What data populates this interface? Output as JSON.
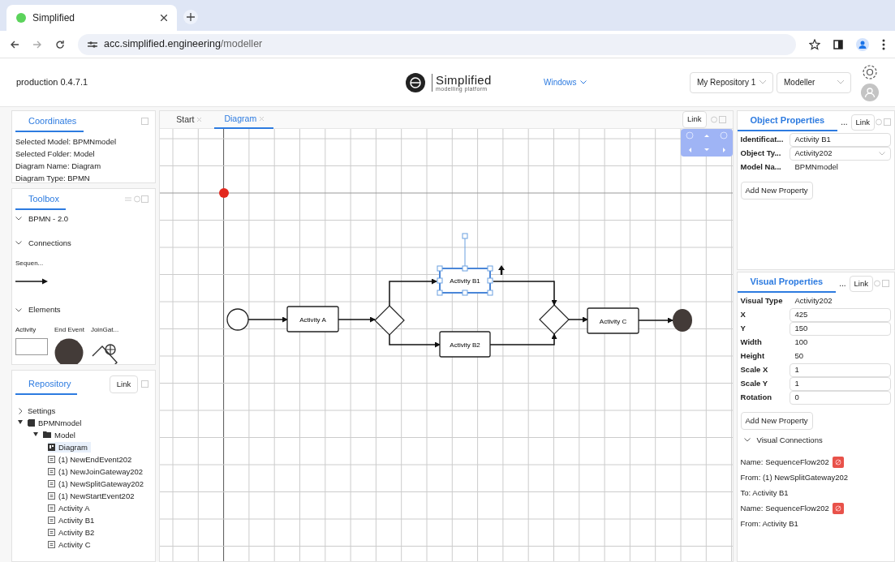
{
  "browser": {
    "tab_title": "Simplified",
    "url_host": "acc.simplified.engineering",
    "url_path": "/modeller"
  },
  "header": {
    "version": "production 0.4.7.1",
    "logo_title": "Simplified",
    "logo_subtitle": "modelling platform",
    "windows_menu": "Windows",
    "repository_select": "My Repository 1",
    "mode_select": "Modeller"
  },
  "coordinates": {
    "title": "Coordinates",
    "lines": [
      "Selected Model: BPMNmodel",
      "Selected Folder: Model",
      "Diagram Name: Diagram",
      "Diagram Type: BPMN"
    ]
  },
  "toolbox": {
    "title": "Toolbox",
    "group": "BPMN - 2.0",
    "connections_label": "Connections",
    "connections": [
      {
        "label": "Sequen..."
      }
    ],
    "elements_label": "Elements",
    "elements": [
      {
        "label": "Activity",
        "kind": "activity"
      },
      {
        "label": "End Event",
        "kind": "end"
      },
      {
        "label": "JoinGat...",
        "kind": "join"
      }
    ]
  },
  "repository": {
    "title": "Repository",
    "link": "Link",
    "tree": [
      {
        "label": "Settings",
        "kind": "folder-toggle",
        "expanded": false,
        "selected": false
      },
      {
        "label": "BPMNmodel",
        "kind": "model",
        "expanded": true,
        "selected": false,
        "children": [
          {
            "label": "Model",
            "kind": "folder",
            "expanded": true,
            "selected": false,
            "children": [
              {
                "label": "Diagram",
                "kind": "diagram",
                "selected": true
              },
              {
                "label": "(1) NewEndEvent202",
                "kind": "object",
                "selected": false
              },
              {
                "label": "(1) NewJoinGateway202",
                "kind": "object",
                "selected": false
              },
              {
                "label": "(1) NewSplitGateway202",
                "kind": "object",
                "selected": false
              },
              {
                "label": "(1) NewStartEvent202",
                "kind": "object",
                "selected": false
              },
              {
                "label": "Activity A",
                "kind": "object",
                "selected": false
              },
              {
                "label": "Activity B1",
                "kind": "object",
                "selected": false
              },
              {
                "label": "Activity B2",
                "kind": "object",
                "selected": false
              },
              {
                "label": "Activity C",
                "kind": "object",
                "selected": false
              }
            ]
          }
        ]
      }
    ]
  },
  "editor": {
    "tabs": [
      {
        "label": "Start",
        "selected": false
      },
      {
        "label": "Diagram",
        "selected": true
      }
    ],
    "link": "Link",
    "nodes": [
      {
        "kind": "start"
      },
      {
        "kind": "activity",
        "label": "Activity A",
        "selected": false
      },
      {
        "kind": "gateway"
      },
      {
        "kind": "activity",
        "label": "Activity B1",
        "selected": true
      },
      {
        "kind": "activity",
        "label": "Activity B2",
        "selected": false
      },
      {
        "kind": "gateway"
      },
      {
        "kind": "activity",
        "label": "Activity C",
        "selected": false
      },
      {
        "kind": "end"
      }
    ]
  },
  "object_properties": {
    "title": "Object Properties",
    "more": "...",
    "link": "Link",
    "rows": [
      {
        "label": "Identificat...",
        "value": "Activity B1",
        "kind": "input"
      },
      {
        "label": "Object Ty...",
        "value": "Activity202",
        "kind": "select"
      },
      {
        "label": "Model Na...",
        "value": "BPMNmodel",
        "kind": "text"
      }
    ],
    "add_button": "Add New Property"
  },
  "visual_properties": {
    "title": "Visual Properties",
    "more": "...",
    "link": "Link",
    "rows": [
      {
        "label": "Visual Type",
        "value": "Activity202",
        "kind": "text"
      },
      {
        "label": "X",
        "value": "425",
        "kind": "input"
      },
      {
        "label": "Y",
        "value": "150",
        "kind": "input"
      },
      {
        "label": "Width",
        "value": "100",
        "kind": "text"
      },
      {
        "label": "Height",
        "value": "50",
        "kind": "text"
      },
      {
        "label": "Scale X",
        "value": "1",
        "kind": "input"
      },
      {
        "label": "Scale Y",
        "value": "1",
        "kind": "input"
      },
      {
        "label": "Rotation",
        "value": "0",
        "kind": "input"
      }
    ],
    "add_button": "Add New Property",
    "connections_label": "Visual Connections",
    "connection_lines": [
      {
        "text": "Name: SequenceFlow202",
        "kind": "name"
      },
      {
        "text": "From: (1) NewSplitGateway202",
        "kind": "plain"
      },
      {
        "text": "To: Activity B1",
        "kind": "plain"
      },
      {
        "text": "Name: SequenceFlow202",
        "kind": "name"
      },
      {
        "text": "From: Activity B1",
        "kind": "plain"
      }
    ]
  }
}
